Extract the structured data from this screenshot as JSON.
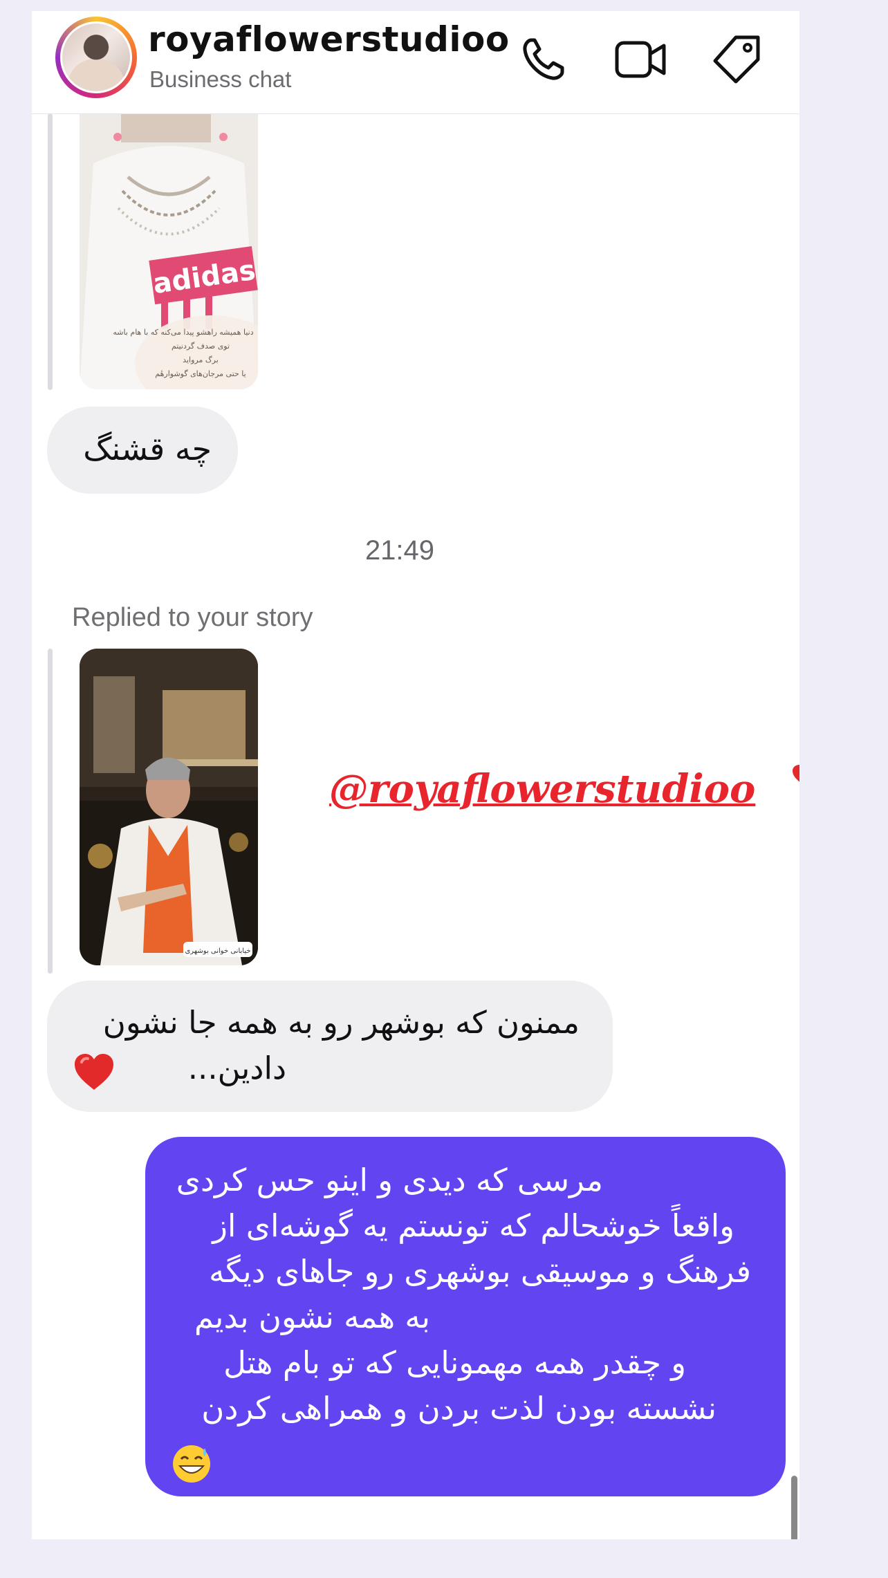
{
  "header": {
    "username": "royaflowerstudioo",
    "subtitle": "Business chat",
    "actions": [
      "phone-icon",
      "video-icon",
      "tag-icon"
    ]
  },
  "messages": {
    "story1_caption_lines": [
      "دنیا همیشه راهشو پیدا می‌کنه که با هام باشه",
      "توی صدف گردنیتم",
      "برگ مرواید",
      "یا حتی مرجان‌های گوشوارهٔم"
    ],
    "story1_shirt_text": "adidas",
    "reply1": "چه قشنگ",
    "timestamp": "21:49",
    "replied_label": "Replied to your story",
    "story2_sticker": "خیابانی خوانی بوشهری",
    "story2_mention": "@royaflowerstudioo",
    "reply2_line1": "ممنون که بوشهر رو به همه جا نشون",
    "reply2_line2": "دادین...",
    "outgoing_lines": [
      "مرسی که دیدی و اینو حس کردی",
      "واقعاً خوشحالم که تونستم یه گوشه‌ای از",
      "فرهنگ و موسیقی بوشهری رو جاهای دیگه",
      "به همه نشون بدیم",
      "و چقدر همه مهمونایی که تو بام هتل",
      "نشسته بودن لذت بردن و همراهی کردن"
    ]
  },
  "colors": {
    "outgoing_bubble": "#6244f1",
    "incoming_bubble": "#efeff2",
    "mention_red": "#e8242c",
    "background": "#efeef8"
  }
}
